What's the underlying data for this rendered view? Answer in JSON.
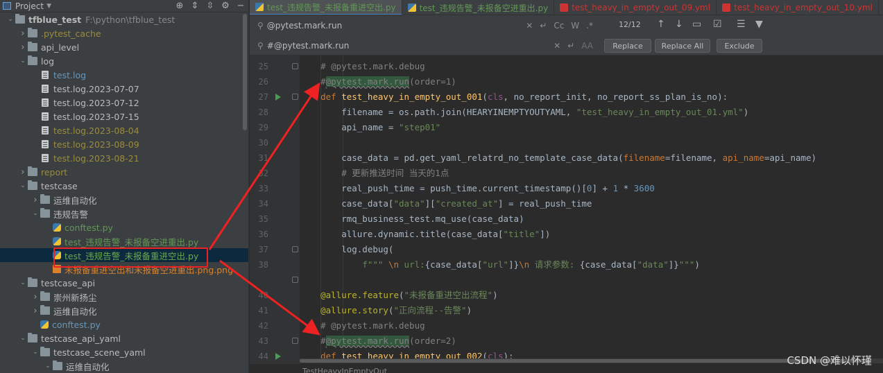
{
  "project_panel": {
    "title": "Project",
    "tree": [
      {
        "depth": 0,
        "expanded": true,
        "icon": "folder-icon",
        "label": "tfblue_test",
        "color": "gray",
        "bold": true,
        "path": "F:\\python\\tfblue_test"
      },
      {
        "depth": 1,
        "expanded": false,
        "icon": "folder-icon",
        "label": ".pytest_cache",
        "color": "olive"
      },
      {
        "depth": 1,
        "expanded": false,
        "icon": "folder-icon",
        "label": "api_level",
        "color": "gray"
      },
      {
        "depth": 1,
        "expanded": true,
        "icon": "folder-icon",
        "label": "log",
        "color": "gray"
      },
      {
        "depth": 2,
        "icon": "file-icon",
        "label": "test.log",
        "color": "blue"
      },
      {
        "depth": 2,
        "icon": "file-icon",
        "label": "test.log.2023-07-07",
        "color": "gray"
      },
      {
        "depth": 2,
        "icon": "file-icon",
        "label": "test.log.2023-07-12",
        "color": "gray"
      },
      {
        "depth": 2,
        "icon": "file-icon",
        "label": "test.log.2023-07-15",
        "color": "gray"
      },
      {
        "depth": 2,
        "icon": "file-icon",
        "label": "test.log.2023-08-04",
        "color": "olive"
      },
      {
        "depth": 2,
        "icon": "file-icon",
        "label": "test.log.2023-08-09",
        "color": "olive"
      },
      {
        "depth": 2,
        "icon": "file-icon",
        "label": "test.log.2023-08-21",
        "color": "olive"
      },
      {
        "depth": 1,
        "expanded": false,
        "icon": "folder-icon",
        "label": "report",
        "color": "olive"
      },
      {
        "depth": 1,
        "expanded": true,
        "icon": "folder-icon",
        "label": "testcase",
        "color": "gray"
      },
      {
        "depth": 2,
        "expanded": false,
        "icon": "folder-icon",
        "label": "运维自动化",
        "color": "gray"
      },
      {
        "depth": 2,
        "expanded": true,
        "icon": "folder-icon",
        "label": "违规告警",
        "color": "gray"
      },
      {
        "depth": 3,
        "icon": "python-file-icon",
        "label": "conftest.py",
        "color": "green"
      },
      {
        "depth": 3,
        "icon": "python-file-icon",
        "label": "test_违规告警_未报备空进重出.py",
        "color": "green"
      },
      {
        "depth": 3,
        "icon": "python-file-icon",
        "label": "test_违规告警_未报备重进空出.py",
        "color": "lgreen",
        "selected": true
      },
      {
        "depth": 3,
        "icon": "image-file-icon",
        "label": "未报备重进空出和未报备空进重出.png.png",
        "color": "orange"
      },
      {
        "depth": 1,
        "expanded": true,
        "icon": "folder-icon",
        "label": "testcase_api",
        "color": "gray"
      },
      {
        "depth": 2,
        "expanded": false,
        "icon": "folder-icon",
        "label": "崇州新扬尘",
        "color": "gray"
      },
      {
        "depth": 2,
        "expanded": false,
        "icon": "folder-icon",
        "label": "运维自动化",
        "color": "gray"
      },
      {
        "depth": 2,
        "icon": "python-file-icon",
        "label": "conftest.py",
        "color": "blue"
      },
      {
        "depth": 1,
        "expanded": true,
        "icon": "folder-icon",
        "label": "testcase_api_yaml",
        "color": "gray"
      },
      {
        "depth": 2,
        "expanded": true,
        "icon": "folder-icon",
        "label": "testcase_scene_yaml",
        "color": "gray"
      },
      {
        "depth": 3,
        "expanded": true,
        "icon": "folder-icon",
        "label": "运维自动化",
        "color": "gray"
      }
    ]
  },
  "tabs": [
    {
      "label": "test_违规告警_未报备重进空出.py",
      "type": "py",
      "active": true
    },
    {
      "label": "test_违规告警_未报备空进重出.py",
      "type": "py",
      "active": false
    },
    {
      "label": "test_heavy_in_empty_out_09.yml",
      "type": "yml",
      "active": false
    },
    {
      "label": "test_heavy_in_empty_out_10.yml",
      "type": "yml",
      "active": false
    }
  ],
  "find_bar": {
    "search_value": "@pytest.mark.run",
    "replace_value": "#@pytest.mark.run",
    "match_count": "12/12",
    "case_label": "Cc",
    "word_label": "W",
    "regex_label": ".*",
    "preserve_case_label": "AA",
    "replace_button": "Replace",
    "replace_all_button": "Replace All",
    "exclude_button": "Exclude"
  },
  "editor": {
    "lines": [
      {
        "num": "25",
        "tokens": [
          {
            "t": "    "
          },
          {
            "t": "# @pytest.mark.debug",
            "c": "cm"
          }
        ]
      },
      {
        "num": "26",
        "tokens": [
          {
            "t": "    "
          },
          {
            "t": "#",
            "c": "cm"
          },
          {
            "t": "@pytest.mark.run",
            "c": "hl"
          },
          {
            "t": "(order=1)",
            "c": "cm"
          }
        ]
      },
      {
        "num": "27",
        "run": true,
        "tokens": [
          {
            "t": "    "
          },
          {
            "t": "def ",
            "c": "k"
          },
          {
            "t": "test_heavy_in_empty_out_001",
            "c": "fn"
          },
          {
            "t": "("
          },
          {
            "t": "cls",
            "c": "p"
          },
          {
            "t": ", no_report_init, no_report_ss_plan_is_no):"
          }
        ]
      },
      {
        "num": "28",
        "tokens": [
          {
            "t": "        filename = os.path.join(HEARYINEMPTYOUTYAML, "
          },
          {
            "t": "\"test_heavy_in_empty_out_01.yml\"",
            "c": "s"
          },
          {
            "t": ")"
          }
        ]
      },
      {
        "num": "29",
        "tokens": [
          {
            "t": "        api_name = "
          },
          {
            "t": "\"step01\"",
            "c": "s"
          }
        ]
      },
      {
        "num": "30",
        "tokens": [
          {
            "t": ""
          }
        ]
      },
      {
        "num": "31",
        "tokens": [
          {
            "t": "        case_data = pd.get_yaml_relatrd_no_template_case_data("
          },
          {
            "t": "filename",
            "c": "k"
          },
          {
            "t": "=filename, "
          },
          {
            "t": "api_name",
            "c": "k"
          },
          {
            "t": "=api_name)"
          }
        ]
      },
      {
        "num": "32",
        "tokens": [
          {
            "t": "        "
          },
          {
            "t": "# 更新推送时间 当天的1点",
            "c": "cm"
          }
        ]
      },
      {
        "num": "33",
        "tokens": [
          {
            "t": "        real_push_time = push_time.current_timestamp()["
          },
          {
            "t": "0",
            "c": "n"
          },
          {
            "t": "] + "
          },
          {
            "t": "1",
            "c": "n"
          },
          {
            "t": " * "
          },
          {
            "t": "3600",
            "c": "n"
          }
        ]
      },
      {
        "num": "34",
        "tokens": [
          {
            "t": "        case_data["
          },
          {
            "t": "\"data\"",
            "c": "s"
          },
          {
            "t": "]["
          },
          {
            "t": "\"created_at\"",
            "c": "s"
          },
          {
            "t": "] = real_push_time"
          }
        ]
      },
      {
        "num": "35",
        "tokens": [
          {
            "t": "        rmq_business_test.mq_use(case_data)"
          }
        ]
      },
      {
        "num": "36",
        "tokens": [
          {
            "t": "        allure.dynamic.title(case_data["
          },
          {
            "t": "\"title\"",
            "c": "s"
          },
          {
            "t": "])"
          }
        ]
      },
      {
        "num": "37",
        "tokens": [
          {
            "t": "        log.debug("
          }
        ]
      },
      {
        "num": "38",
        "tokens": [
          {
            "t": "            "
          },
          {
            "t": "f\"\"\" ",
            "c": "s"
          },
          {
            "t": "\\n",
            "c": "k"
          },
          {
            "t": " url:",
            "c": "s"
          },
          {
            "t": "{case_data["
          },
          {
            "t": "\"url\"",
            "c": "s"
          },
          {
            "t": "]}"
          },
          {
            "t": "\\n",
            "c": "k"
          },
          {
            "t": " 请求参数: ",
            "c": "s"
          },
          {
            "t": "{case_data["
          },
          {
            "t": "\"data\"",
            "c": "s"
          },
          {
            "t": "]}"
          },
          {
            "t": "\"\"\"",
            "c": "s"
          },
          {
            "t": ")"
          }
        ]
      },
      {
        "num": "",
        "tokens": [
          {
            "t": ""
          }
        ]
      },
      {
        "num": "40",
        "tokens": [
          {
            "t": "    "
          },
          {
            "t": "@allure.feature",
            "c": "dc"
          },
          {
            "t": "("
          },
          {
            "t": "\"未报备重进空出流程\"",
            "c": "s"
          },
          {
            "t": ")"
          }
        ]
      },
      {
        "num": "41",
        "tokens": [
          {
            "t": "    "
          },
          {
            "t": "@allure.story",
            "c": "dc"
          },
          {
            "t": "("
          },
          {
            "t": "\"正向流程--告警\"",
            "c": "s"
          },
          {
            "t": ")"
          }
        ]
      },
      {
        "num": "42",
        "tokens": [
          {
            "t": "    "
          },
          {
            "t": "# @pytest.mark.debug",
            "c": "cm"
          }
        ]
      },
      {
        "num": "43",
        "tokens": [
          {
            "t": "    "
          },
          {
            "t": "#",
            "c": "cm"
          },
          {
            "t": "@pytest.mark.run",
            "c": "hl"
          },
          {
            "t": "(order=2)",
            "c": "cm"
          }
        ]
      },
      {
        "num": "44",
        "run": true,
        "tokens": [
          {
            "t": "    "
          },
          {
            "t": "def ",
            "c": "k"
          },
          {
            "t": "test_heavy_in_empty_out_002",
            "c": "fn"
          },
          {
            "t": "("
          },
          {
            "t": "cls",
            "c": "p"
          },
          {
            "t": "):"
          }
        ]
      }
    ]
  },
  "breadcrumb": "TestHeavyInEmptyOut",
  "watermark": "CSDN @难以怀瑾",
  "colors": {
    "annotation": "#ee2222",
    "selection": "#0d293e",
    "match_highlight": "#32593d"
  }
}
